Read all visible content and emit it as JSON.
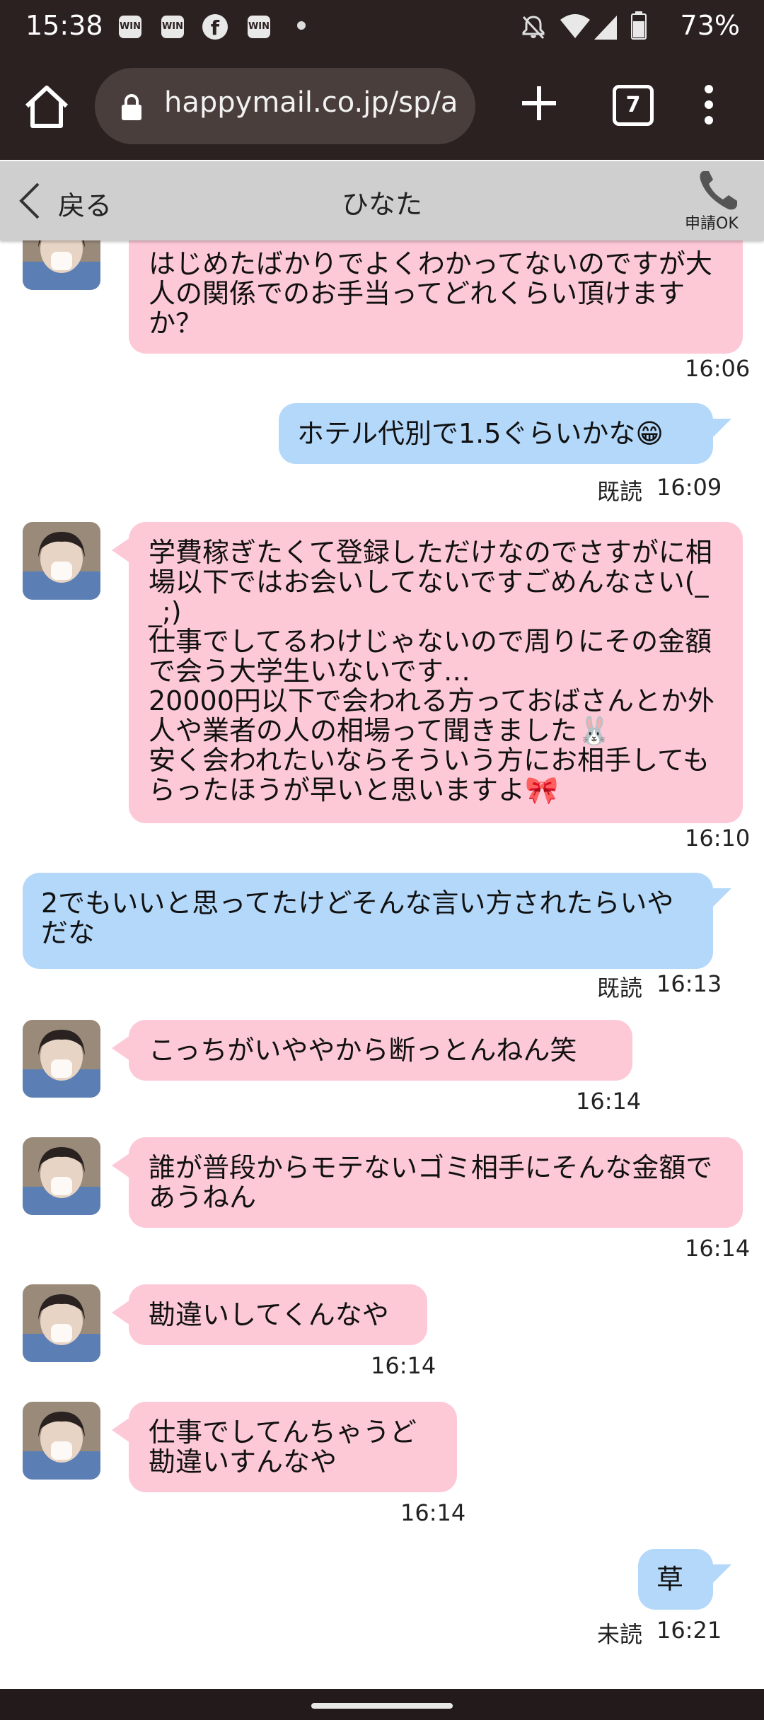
{
  "status_bar": {
    "time": "15:38",
    "notif_icons": [
      "WIN",
      "WIN",
      "facebook-icon",
      "WIN"
    ],
    "battery": "73%"
  },
  "browser": {
    "url": "happymail.co.jp/sp/a",
    "tab_count": "7"
  },
  "header": {
    "back_label": "戻る",
    "title": "ひなた",
    "call_label": "申請OK"
  },
  "messages": [
    {
      "from": "her",
      "text": "はじめたばかりでよくわかってないのですが大人の関係でのお手当ってどれくらい頂けますか？",
      "time": "16:06"
    },
    {
      "from": "me",
      "text": "ホテル代別で1.5ぐらいかな😁",
      "status": "既読",
      "time": "16:09"
    },
    {
      "from": "her",
      "text": "学費稼ぎたくて登録しただけなのでさすがに相場以下ではお会いしてないですごめんなさい(_ _;)\n仕事でしてるわけじゃないので周りにその金額で会う大学生いないです…\n20000円以下で会われる方っておばさんとか外人や業者の人の相場って聞きました🐰\n安く会われたいならそういう方にお相手してもらったほうが早いと思いますよ🎀",
      "time": "16:10"
    },
    {
      "from": "me",
      "text": "2でもいいと思ってたけどそんな言い方されたらいやだな",
      "status": "既読",
      "time": "16:13"
    },
    {
      "from": "her",
      "text": "こっちがいややから断っとんねん笑",
      "time": "16:14"
    },
    {
      "from": "her",
      "text": "誰が普段からモテないゴミ相手にそんな金額であうねん",
      "time": "16:14"
    },
    {
      "from": "her",
      "text": "勘違いしてくんなや",
      "time": "16:14"
    },
    {
      "from": "her",
      "text": "仕事でしてんちゃうど\n勘違いすんなや",
      "time": "16:14"
    },
    {
      "from": "me",
      "text": "草",
      "status": "未読",
      "time": "16:21"
    }
  ],
  "colors": {
    "status_bg": "#2b2121",
    "header_bg": "#cfcfcf",
    "incoming_bubble": "#fdc9d7",
    "outgoing_bubble": "#b4d8fa"
  }
}
